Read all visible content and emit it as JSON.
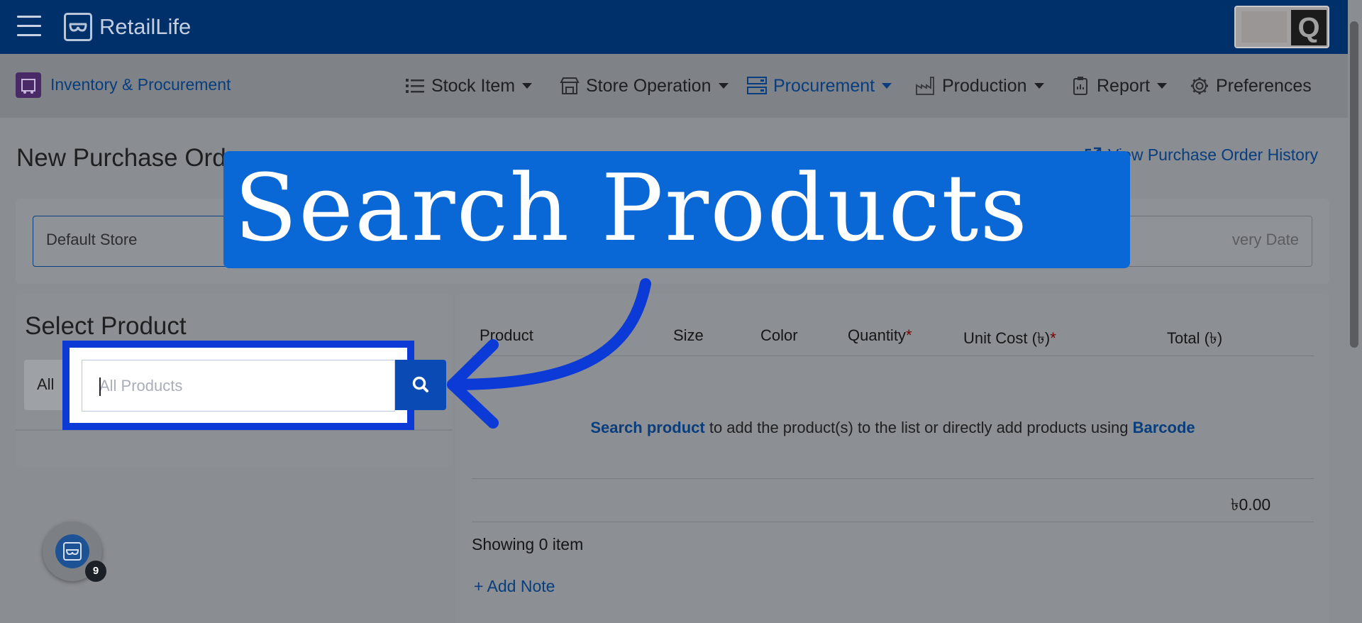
{
  "app": {
    "brand": "RetailLife"
  },
  "nav": {
    "module": "Inventory & Procurement",
    "items": [
      {
        "label": "Stock Item",
        "icon": "list-icon"
      },
      {
        "label": "Store Operation",
        "icon": "store-icon"
      },
      {
        "label": "Procurement",
        "icon": "procurement-icon",
        "active": true
      },
      {
        "label": "Production",
        "icon": "factory-icon"
      },
      {
        "label": "Report",
        "icon": "clipboard-icon"
      },
      {
        "label": "Preferences",
        "icon": "gear-icon"
      }
    ]
  },
  "page": {
    "title": "New Purchase Ord",
    "history_link": "View Purchase Order History",
    "store_field": "Default Store",
    "delivery_field": "very Date"
  },
  "select_product": {
    "title": "Select Product",
    "category": "All",
    "search_placeholder": "All Products"
  },
  "table": {
    "headers": {
      "product": "Product",
      "size": "Size",
      "color": "Color",
      "quantity": "Quantity",
      "unit_cost": "Unit Cost (৳)",
      "total": "Total (৳)"
    },
    "required_mark": "*",
    "empty_lead": "Search product",
    "empty_middle": " to add the product(s) to the list or directly add products using ",
    "empty_tail": "Barcode",
    "total_value": "৳0.00",
    "showing": "Showing 0 item",
    "add_note": "+ Add Note"
  },
  "chat": {
    "badge": "9"
  },
  "overlay": {
    "banner": "Search Products"
  },
  "colors": {
    "topbar": "#00306a",
    "accent": "#083d7e",
    "banner": "#0a67d6",
    "highlight": "#0b3ad6"
  }
}
